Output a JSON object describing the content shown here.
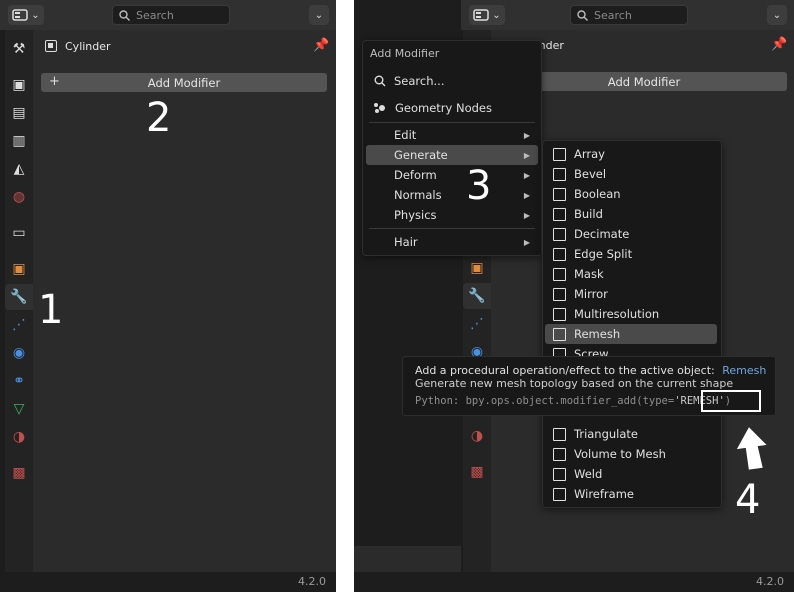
{
  "left": {
    "search_placeholder": "Search",
    "object_name": "Cylinder",
    "add_modifier_label": "Add Modifier",
    "version": "4.2.0",
    "step_1": "1",
    "step_2": "2"
  },
  "right": {
    "search_placeholder": "Search",
    "object_name": "Cylinder",
    "object_name_partial": "ylinder",
    "add_modifier_label": "Add Modifier",
    "version": "4.2.0",
    "step_3": "3",
    "step_4": "4",
    "add_menu": {
      "title": "Add Modifier",
      "search": "Search...",
      "geometry_nodes": "Geometry Nodes",
      "categories": [
        "Edit",
        "Generate",
        "Deform",
        "Normals",
        "Physics"
      ],
      "hair": "Hair"
    },
    "generate_menu": {
      "items": [
        "Array",
        "Bevel",
        "Boolean",
        "Build",
        "Decimate",
        "Edge Split",
        "Mask",
        "Mirror",
        "Multiresolution",
        "Remesh",
        "Screw"
      ],
      "items_below": [
        "Triangulate",
        "Volume to Mesh",
        "Weld",
        "Wireframe"
      ],
      "highlighted": "Remesh"
    },
    "tooltip": {
      "line1": "Add a procedural operation/effect to the active object:",
      "line1_highlight": "Remesh",
      "line2": "Generate new mesh topology based on the current shape",
      "python_prefix": "Python: bpy.ops.object.modifier_add(type=",
      "python_value": "'REMESH'",
      "python_suffix": ")"
    }
  },
  "colors": {
    "accent_blue": "#4a8fe0",
    "tooltip_highlight": "#6fa8dc"
  }
}
